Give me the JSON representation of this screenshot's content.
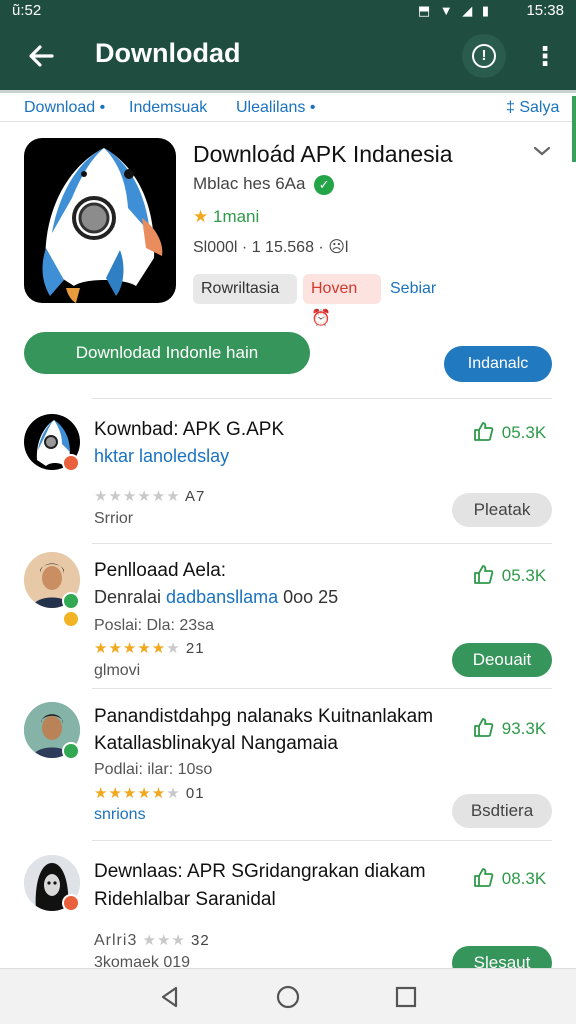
{
  "status_bar": {
    "time_left": "ũ:52",
    "icons": "⬒ ▼ ◢ ▮",
    "time_right": "15:38"
  },
  "app_bar": {
    "title": "Downlodad"
  },
  "tabs": [
    "Download •",
    "Indemsuak",
    "Ulealilans •",
    "‡ Salya"
  ],
  "app": {
    "name": "Downloád APK Indanesia",
    "developer": "Mblac hes 6Aa",
    "rating_label": "1mani",
    "meta": "Sl000l · 1 15.568 · ☹l",
    "chips": [
      "Rowriltasia",
      "Hoven",
      "Sebiar"
    ]
  },
  "buttons": {
    "primary": "Downlodad Indonle hain",
    "secondary": "Indanalc"
  },
  "list": [
    {
      "title": "Kownbad: APK G.APK",
      "subtitle": "hktar lanoledslay",
      "stars_on": 0,
      "stars_total": 6,
      "stars_text": "A7",
      "small": "Srrior",
      "likes": "05.3K",
      "button": "Pleatak",
      "button_style": "grey"
    },
    {
      "title": "Penlloaad Aela:",
      "subtitle_dark": "Denralai ",
      "subtitle_blue": "dadbansllama",
      "subtitle_tail": " 0oo 25",
      "small": "Poslai: Dla: 23sa",
      "stars_on": 5,
      "stars_total": 6,
      "stars_text": "21",
      "small2": "glmovi",
      "likes": "05.3K",
      "button": "Deouait",
      "button_style": "green"
    },
    {
      "title": "Panandistdahpg nalanaks Kuitnanlakam",
      "title2": "Katallasblinakyal Nangamaia",
      "small": "Podlai: ilar: 10so",
      "stars_on": 5,
      "stars_total": 6,
      "stars_text": "01",
      "small2": "snrions",
      "likes": "93.3K",
      "button": "Bsdtiera",
      "button_style": "grey"
    },
    {
      "title": "Dewnlaas: APR SGridangrakan diakam",
      "title2": "Ridehlalbar Saranidal",
      "small": "Arlri3",
      "stars_on": 0,
      "stars_total": 3,
      "stars_text": "32",
      "small2": "3komaek 019",
      "likes": "08.3K",
      "button": "Slesaut",
      "button_style": "green"
    }
  ],
  "colors": {
    "app_bar": "#1f4d40",
    "accent_green": "#35955a",
    "accent_blue": "#2179c0",
    "star": "#f0a81e"
  }
}
